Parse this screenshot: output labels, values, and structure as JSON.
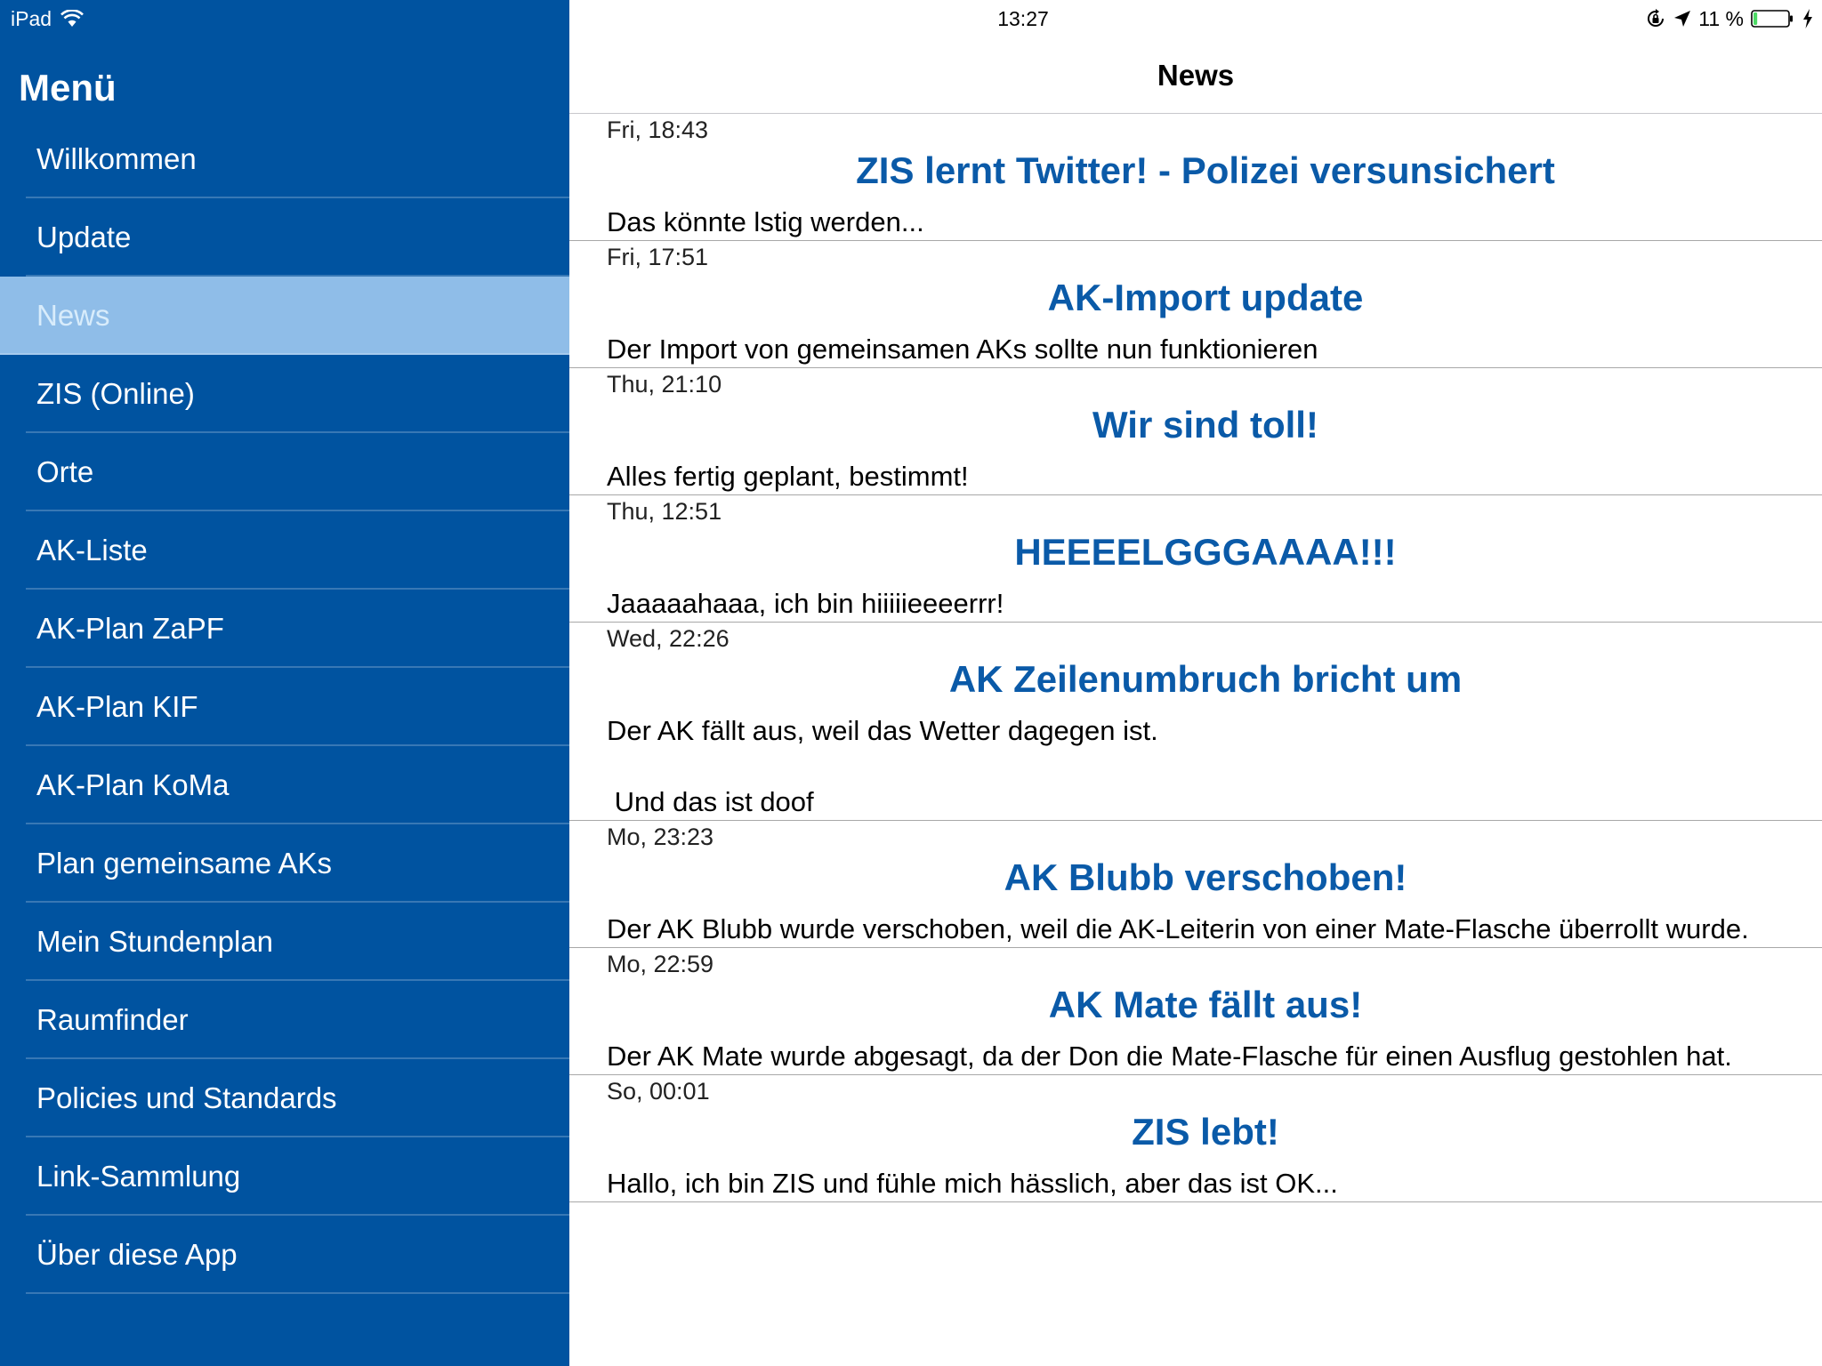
{
  "status_bar": {
    "device": "iPad",
    "time": "13:27",
    "battery": "11 %",
    "battery_level": 0.11
  },
  "sidebar": {
    "title": "Menü",
    "items": [
      {
        "label": "Willkommen",
        "selected": false
      },
      {
        "label": "Update",
        "selected": false
      },
      {
        "label": "News",
        "selected": true
      },
      {
        "label": "ZIS (Online)",
        "selected": false
      },
      {
        "label": "Orte",
        "selected": false
      },
      {
        "label": "AK-Liste",
        "selected": false
      },
      {
        "label": "AK-Plan ZaPF",
        "selected": false
      },
      {
        "label": "AK-Plan KIF",
        "selected": false
      },
      {
        "label": "AK-Plan KoMa",
        "selected": false
      },
      {
        "label": "Plan gemeinsame AKs",
        "selected": false
      },
      {
        "label": "Mein Stundenplan",
        "selected": false
      },
      {
        "label": "Raumfinder",
        "selected": false
      },
      {
        "label": "Policies und Standards",
        "selected": false
      },
      {
        "label": "Link-Sammlung",
        "selected": false
      },
      {
        "label": "Über diese App",
        "selected": false
      }
    ]
  },
  "main": {
    "title": "News",
    "news": [
      {
        "date": "Fri, 18:43",
        "title": "ZIS lernt Twitter! - Polizei versunsichert",
        "body": "Das könnte lstig werden..."
      },
      {
        "date": "Fri, 17:51",
        "title": "AK-Import update",
        "body": "Der Import von gemeinsamen AKs sollte nun funktionieren"
      },
      {
        "date": "Thu, 21:10",
        "title": "Wir sind toll!",
        "body": "Alles fertig geplant, bestimmt!"
      },
      {
        "date": "Thu, 12:51",
        "title": "HEEEELGGGAAAA!!!",
        "body": "Jaaaaahaaa, ich bin hiiiiieeeerrr!"
      },
      {
        "date": "Wed, 22:26",
        "title": "AK Zeilenumbruch bricht um",
        "body": "Der AK fällt aus, weil das Wetter dagegen ist.\n\n Und das ist doof"
      },
      {
        "date": "Mo, 23:23",
        "title": "AK Blubb verschoben!",
        "body": "Der AK Blubb wurde verschoben, weil die AK-Leiterin von einer Mate-Flasche überrollt wurde."
      },
      {
        "date": "Mo, 22:59",
        "title": "AK Mate fällt aus!",
        "body": "Der AK Mate wurde abgesagt, da der Don die Mate-Flasche für einen Ausflug gestohlen hat."
      },
      {
        "date": "So, 00:01",
        "title": "ZIS lebt!",
        "body": "Hallo, ich bin ZIS und fühle mich hässlich, aber das ist OK..."
      }
    ]
  },
  "colors": {
    "sidebar_bg": "#0053a0",
    "selected_bg": "#8fbde8",
    "title_blue": "#0a5aa8",
    "battery_green": "#4cd964"
  }
}
